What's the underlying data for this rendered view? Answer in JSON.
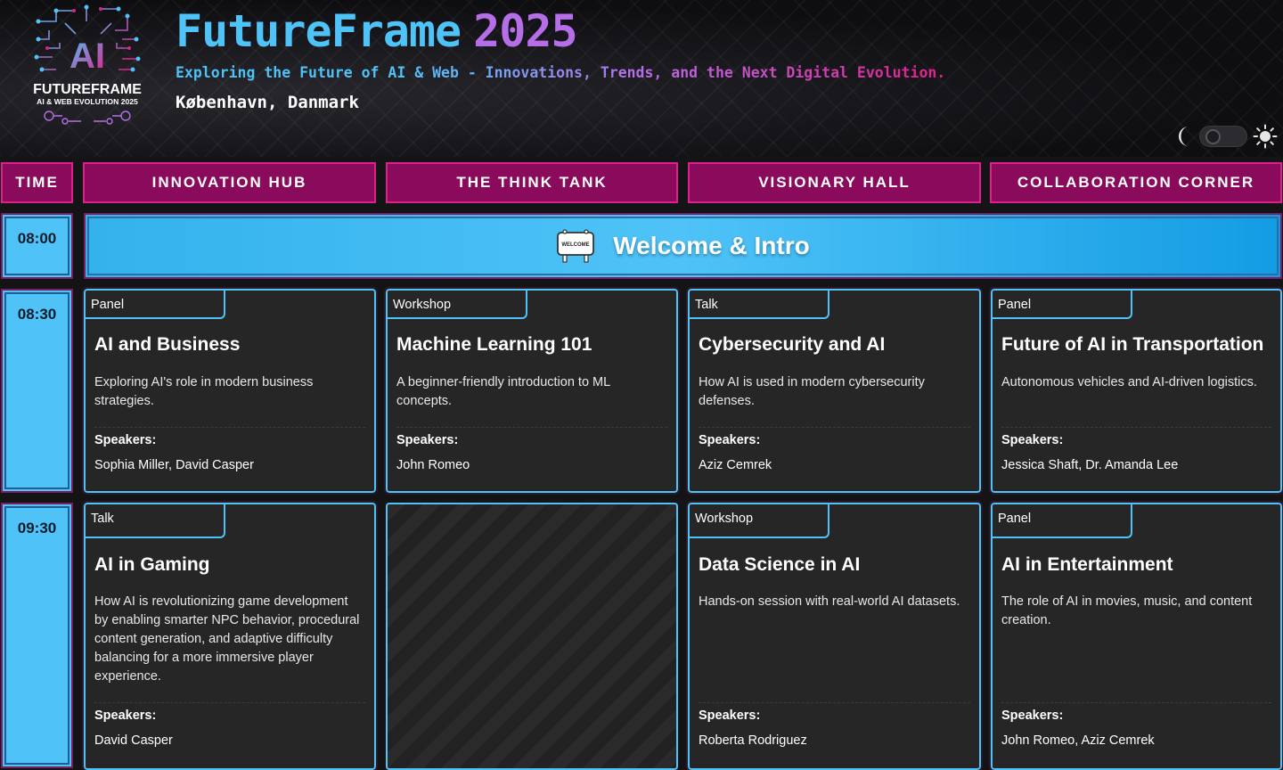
{
  "header": {
    "logo_text_line1": "AI",
    "logo_text_line2": "FUTUREFRAME",
    "logo_text_line3": "AI & WEB EVOLUTION 2025",
    "title_main": "FutureFrame",
    "title_year": "2025",
    "subtitle": "Exploring the Future of AI & Web - Innovations, Trends, and the Next Digital Evolution.",
    "location": "København, Danmark"
  },
  "theme_toggle": {
    "moon_icon": "moon-icon",
    "sun_icon": "sun-icon",
    "mode": "dark"
  },
  "columns": [
    "TIME",
    "INNOVATION HUB",
    "THE THINK TANK",
    "VISIONARY HALL",
    "COLLABORATION CORNER"
  ],
  "times": [
    "08:00",
    "08:30",
    "09:30"
  ],
  "welcome": {
    "icon": "welcome-sign-icon",
    "sign_text": "WELCOME",
    "title": "Welcome & Intro"
  },
  "sessions_0830": [
    {
      "type": "Panel",
      "title": "AI and Business",
      "desc": "Exploring AI's role in modern business strategies.",
      "speakers_label": "Speakers:",
      "speakers": "Sophia Miller, David Casper"
    },
    {
      "type": "Workshop",
      "title": "Machine Learning 101",
      "desc": "A beginner-friendly introduction to ML concepts.",
      "speakers_label": "Speakers:",
      "speakers": "John Romeo"
    },
    {
      "type": "Talk",
      "title": "Cybersecurity and AI",
      "desc": "How AI is used in modern cybersecurity defenses.",
      "speakers_label": "Speakers:",
      "speakers": "Aziz Cemrek"
    },
    {
      "type": "Panel",
      "title": "Future of AI in Transportation",
      "desc": "Autonomous vehicles and AI-driven logistics.",
      "speakers_label": "Speakers:",
      "speakers": "Jessica Shaft, Dr. Amanda Lee"
    }
  ],
  "sessions_0930": [
    {
      "type": "Talk",
      "title": "AI in Gaming",
      "desc": "How AI is revolutionizing game development by enabling smarter NPC behavior, procedural content generation, and adaptive difficulty balancing for a more immersive player experience.",
      "speakers_label": "Speakers:",
      "speakers": "David Casper"
    },
    {
      "type": "Workshop",
      "title": "Data Science in AI",
      "desc": "Hands-on session with real-world AI datasets.",
      "speakers_label": "Speakers:",
      "speakers": "Roberta Rodriguez"
    },
    {
      "type": "Panel",
      "title": "AI in Entertainment",
      "desc": "The role of AI in movies, music, and content creation.",
      "speakers_label": "Speakers:",
      "speakers": "John Romeo, Aziz Cemrek"
    }
  ],
  "colors": {
    "accent_blue": "#4fc3f7",
    "accent_magenta": "#e0208a",
    "header_purple": "#b66ee8",
    "card_bg": "#262626"
  }
}
